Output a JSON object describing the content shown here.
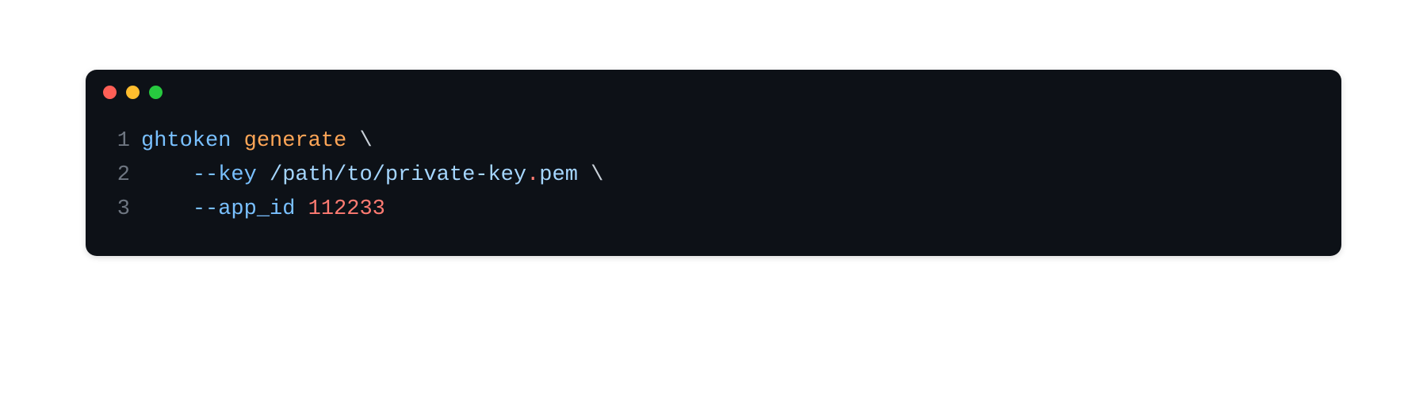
{
  "terminal": {
    "traffic_lights": {
      "red": "#ff5f56",
      "yellow": "#ffbd2e",
      "green": "#27c93f"
    },
    "lines": [
      {
        "number": "1"
      },
      {
        "number": "2"
      },
      {
        "number": "3"
      }
    ],
    "code": {
      "line1": {
        "cmd": "ghtoken",
        "subcmd": "generate",
        "cont": "\\"
      },
      "line2": {
        "indent": "    ",
        "flag": "--key",
        "path_prefix": "/path/to/private-key",
        "dot": ".",
        "path_ext": "pem",
        "cont": "\\"
      },
      "line3": {
        "indent": "    ",
        "flag": "--app_id",
        "value": "112233"
      }
    }
  }
}
